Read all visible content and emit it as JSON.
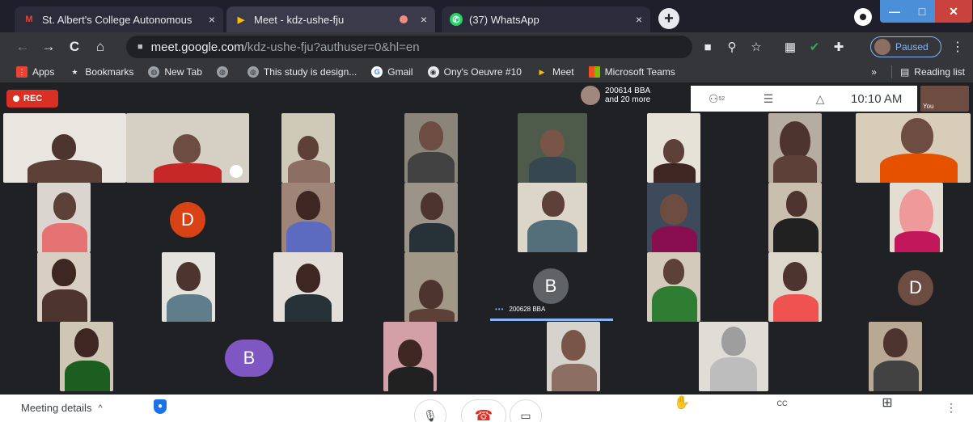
{
  "tabs": [
    {
      "label": "St. Albert's College Autonomous",
      "close": "×",
      "icon_color": "#ea4335",
      "icon_glyph": "M"
    },
    {
      "label": "Meet - kdz-ushe-fju",
      "close": "×",
      "icon_color": "#00897b",
      "icon_glyph": "▶"
    },
    {
      "label": "(37) WhatsApp",
      "close": "×",
      "icon_color": "#25d366",
      "icon_glyph": "✆"
    }
  ],
  "new_tab_glyph": "+",
  "window_controls": {
    "minimize": "—",
    "maximize": "□",
    "close": "✕"
  },
  "nav": {
    "back": "←",
    "forward": "→",
    "reload": "C",
    "home": "⌂"
  },
  "address": {
    "domain": "meet.google.com",
    "path": "/kdz-ushe-fju?authuser=0&hl=en"
  },
  "toolbar_icons": [
    "camera-icon",
    "zoom-icon",
    "star-icon",
    "apps-grid-icon",
    "check-icon",
    "extensions-icon"
  ],
  "toolbar_glyphs": [
    "■",
    "⚲",
    "☆",
    "▦",
    "✔",
    "✚"
  ],
  "profile": {
    "label": "Paused"
  },
  "bookmarks": [
    {
      "label": "Apps",
      "icon": "apps-grid-icon",
      "color": "#ea4335",
      "glyph": "⋮"
    },
    {
      "label": "Bookmarks",
      "icon": "star-icon",
      "color": "#35363a",
      "glyph": "★"
    },
    {
      "label": "New Tab",
      "icon": "chrome-icon",
      "color": "#9aa0a6",
      "glyph": "◍"
    },
    {
      "label": "",
      "icon": "chrome-icon",
      "color": "#9aa0a6",
      "glyph": "◍"
    },
    {
      "label": "This study is design...",
      "icon": "chrome-icon",
      "color": "#9aa0a6",
      "glyph": "◍"
    },
    {
      "label": "Gmail",
      "icon": "google-icon",
      "color": "#ffffff",
      "glyph": "G"
    },
    {
      "label": "Ony's Oeuvre #10",
      "icon": "site-icon",
      "color": "#e8eaed",
      "glyph": "◉"
    },
    {
      "label": "Meet",
      "icon": "meet-icon",
      "color": "#00897b",
      "glyph": "▶"
    },
    {
      "label": "Microsoft Teams",
      "icon": "teams-icon",
      "color": "#f25022",
      "glyph": "▦"
    }
  ],
  "bookmarks_more": "»",
  "reading_list": "Reading list",
  "meet": {
    "rec_label": "REC",
    "presenter": {
      "line1": "200614 BBA",
      "line2": "and 20 more"
    },
    "participants_count": "52",
    "participants_glyph": "⚇",
    "chat_glyph": "☰",
    "activities_glyph": "△",
    "time": "10:10 AM",
    "self_label": "You",
    "pinned_label": "200628 BBA",
    "pinned_dots": "•••",
    "avatars": [
      {
        "letter": "D",
        "color": "#d84315"
      },
      {
        "letter": "B",
        "color": "#5f6368"
      },
      {
        "letter": "D",
        "color": "#6d4c41"
      },
      {
        "letter": "B",
        "color": "#7e57c2"
      }
    ]
  },
  "bottom": {
    "meeting_details": "Meeting details",
    "chevron": "^",
    "shield_glyph": "●",
    "mic_glyph": "🎙",
    "hangup_glyph": "☎",
    "camera_glyph": "▭",
    "raise_hand_glyph": "✋",
    "captions_glyph": "CC",
    "present_glyph": "⊞",
    "more_glyph": "⋮"
  }
}
